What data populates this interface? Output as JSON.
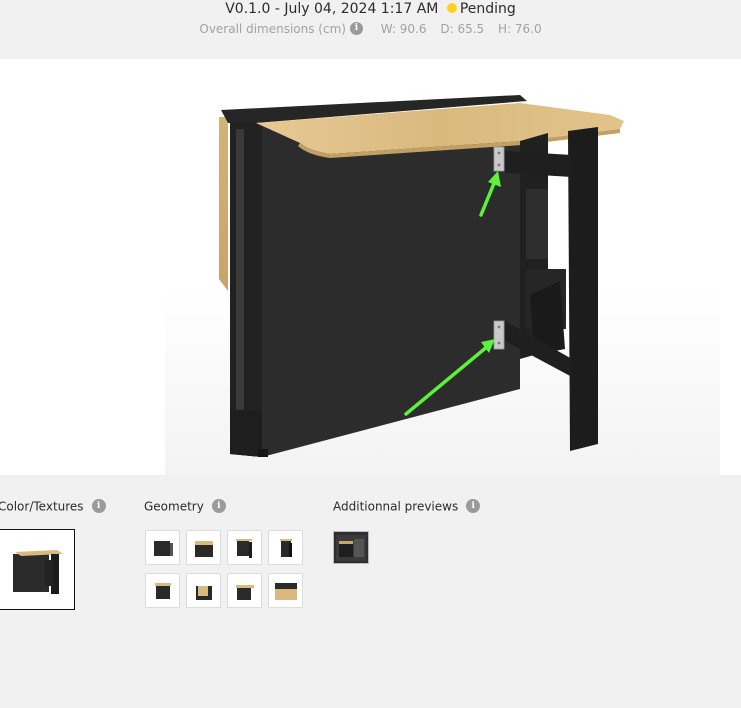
{
  "header": {
    "version": "V0.1.0",
    "separator": "-",
    "date": "July 04, 2024 1:17 AM",
    "status": "Pending",
    "status_color": "#ffd21f",
    "dimensions_label": "Overall dimensions (cm)",
    "width": "W: 90.6",
    "depth": "D: 65.5",
    "height": "H: 76.0"
  },
  "annotation": {
    "arrow_color": "#5cf23a",
    "arrow_count": 2
  },
  "sections": {
    "color_textures": {
      "title": "Color/Textures",
      "info_icon": "info-icon"
    },
    "geometry": {
      "title": "Geometry",
      "info_icon": "info-icon",
      "thumbnail_count": 8
    },
    "additional_previews": {
      "title": "Additionnal previews",
      "info_icon": "info-icon",
      "thumbnail_count": 1
    }
  },
  "colors": {
    "wood": "#d9b97e",
    "panel_black": "#2a2a2a",
    "accent_dark": "#1c1c1c"
  }
}
